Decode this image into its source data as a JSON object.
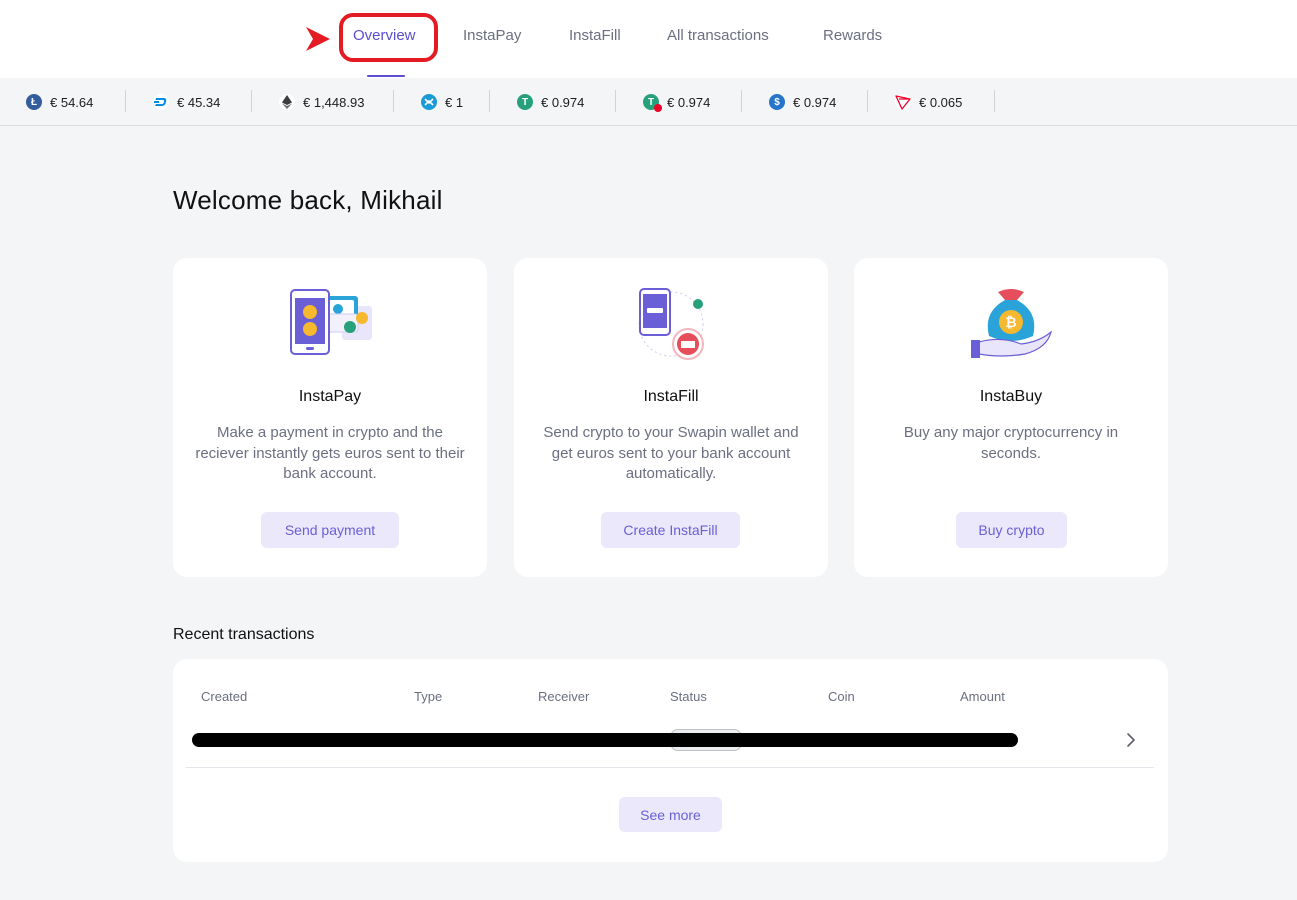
{
  "nav": {
    "tabs": [
      {
        "label": "Overview",
        "active": true
      },
      {
        "label": "InstaPay"
      },
      {
        "label": "InstaFill"
      },
      {
        "label": "All transactions"
      },
      {
        "label": "Rewards"
      }
    ]
  },
  "ticker": [
    {
      "icon": "litecoin-icon",
      "price": "€ 54.64",
      "color": "#345d9d"
    },
    {
      "icon": "dash-icon",
      "price": "€ 45.34",
      "color": "#008ce7"
    },
    {
      "icon": "ethereum-icon",
      "price": "€ 1,448.93",
      "color": "#3c3c3d"
    },
    {
      "icon": "xrp-icon",
      "price": "€ 1",
      "color": "#1a9bd7"
    },
    {
      "icon": "tether-icon",
      "price": "€ 0.974",
      "color": "#26a17b"
    },
    {
      "icon": "tether-tron-icon",
      "price": "€ 0.974",
      "color": "#26a17b"
    },
    {
      "icon": "usdc-icon",
      "price": "€ 0.974",
      "color": "#2775ca"
    },
    {
      "icon": "tron-icon",
      "price": "€ 0.065",
      "color": "#ef0027"
    }
  ],
  "welcome": "Welcome back, Mikhail",
  "cards": [
    {
      "icon": "instapay-illustration-icon",
      "title": "InstaPay",
      "description": "Make a payment in crypto and the reciever instantly gets euros sent to their bank account.",
      "button": "Send payment"
    },
    {
      "icon": "instafill-illustration-icon",
      "title": "InstaFill",
      "description": "Send crypto to your Swapin wallet and get euros sent to your bank account automatically.",
      "button": "Create InstaFill"
    },
    {
      "icon": "instabuy-illustration-icon",
      "title": "InstaBuy",
      "description": "Buy any major cryptocurrency in seconds.",
      "button": "Buy crypto"
    }
  ],
  "recent": {
    "title": "Recent transactions",
    "columns": [
      "Created",
      "Type",
      "Receiver",
      "Status",
      "Coin",
      "Amount"
    ],
    "see_more": "See more"
  },
  "colors": {
    "accent": "#5b4ecf",
    "button_bg": "#ebe8fb",
    "highlight": "#e31b23"
  }
}
